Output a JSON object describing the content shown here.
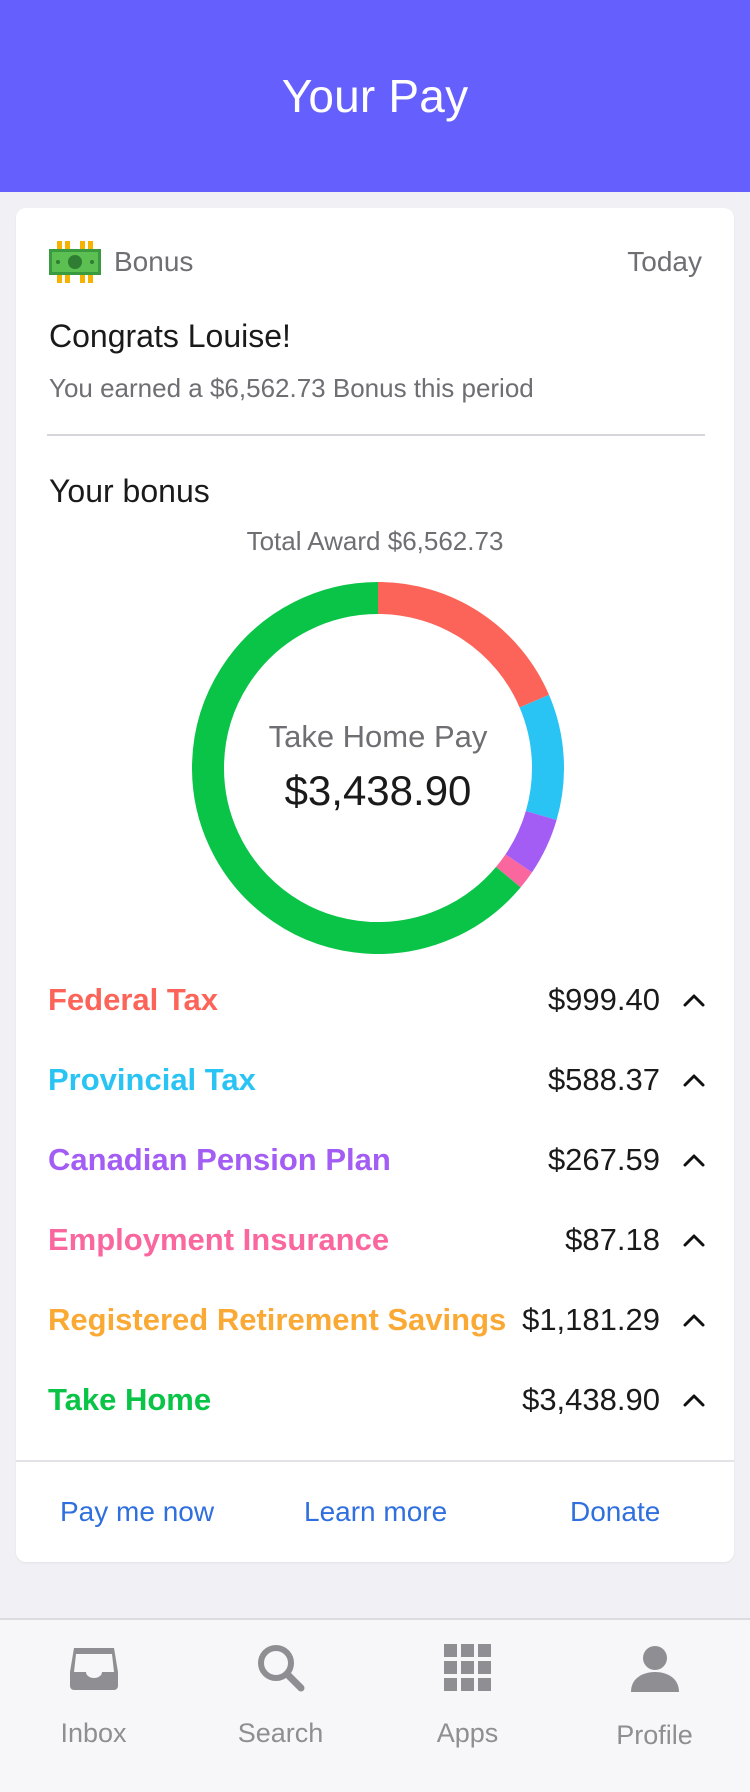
{
  "header": {
    "title": "Your Pay"
  },
  "card": {
    "type": "Bonus",
    "date": "Today",
    "congrats": "Congrats Louise!",
    "earned_text": "You earned a $6,562.73 Bonus this period",
    "section_title": "Your bonus",
    "total_award": "Total Award $6,562.73",
    "center_label": "Take Home Pay",
    "center_value": "$3,438.90",
    "actions": [
      "Pay me now",
      "Learn more",
      "Donate"
    ]
  },
  "chart_data": {
    "type": "pie",
    "total": 6562.73,
    "slices": [
      {
        "label": "Federal Tax",
        "value": 999.4,
        "amount": "$999.40",
        "color": "#fd6459"
      },
      {
        "label": "Provincial Tax",
        "value": 588.37,
        "amount": "$588.37",
        "color": "#2ac4f4"
      },
      {
        "label": "Canadian Pension Plan",
        "value": 267.59,
        "amount": "$267.59",
        "color": "#a35df4"
      },
      {
        "label": "Employment Insurance",
        "value": 87.18,
        "amount": "$87.18",
        "color": "#f9679e"
      },
      {
        "label": "Registered Retirement Savings",
        "value": 1181.29,
        "amount": "$1,181.29",
        "color": "#fba935"
      },
      {
        "label": "Take Home",
        "value": 3438.9,
        "amount": "$3,438.90",
        "color": "#0ac448"
      }
    ]
  },
  "tabbar": {
    "items": [
      {
        "label": "Inbox",
        "icon": "inbox-icon"
      },
      {
        "label": "Search",
        "icon": "search-icon"
      },
      {
        "label": "Apps",
        "icon": "apps-grid-icon"
      },
      {
        "label": "Profile",
        "icon": "profile-icon"
      }
    ]
  }
}
